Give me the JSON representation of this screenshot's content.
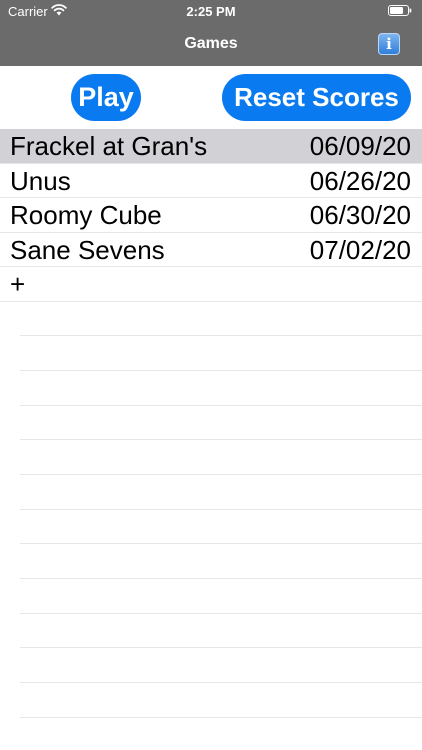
{
  "status_bar": {
    "carrier": "Carrier",
    "time": "2:25 PM"
  },
  "nav": {
    "title": "Games",
    "info_icon": "info-icon",
    "info_glyph": "i"
  },
  "toolbar": {
    "play_label": "Play",
    "reset_label": "Reset Scores"
  },
  "games": [
    {
      "name": "Frackel at Gran's",
      "date": "06/09/20",
      "selected": true
    },
    {
      "name": "Unus",
      "date": "06/26/20",
      "selected": false
    },
    {
      "name": "Roomy Cube",
      "date": "06/30/20",
      "selected": false
    },
    {
      "name": "Sane Sevens",
      "date": "07/02/20",
      "selected": false
    }
  ],
  "add_row": {
    "label": "+"
  },
  "colors": {
    "bar_background": "#6b6b6b",
    "accent": "#0a7af0",
    "selection": "#d1d1d6"
  }
}
